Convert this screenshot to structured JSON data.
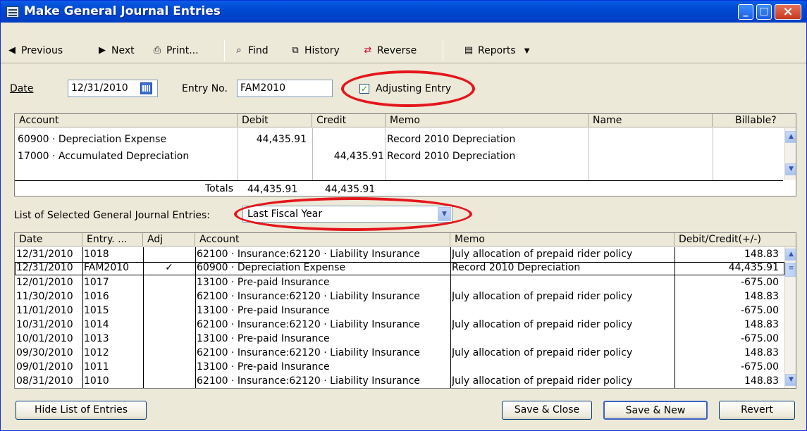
{
  "window": {
    "title": "Make General Journal Entries",
    "min": "_",
    "max": "□",
    "close": "×"
  },
  "toolbar": {
    "previous": "Previous",
    "next": "Next",
    "print": "Print...",
    "find": "Find",
    "history": "History",
    "reverse": "Reverse",
    "reports": "Reports",
    "reports_arrow": "▼"
  },
  "form": {
    "date_label": "Date",
    "date_value": "12/31/2010",
    "entry_label": "Entry No.",
    "entry_value": "FAM2010",
    "adjusting_label": "Adjusting Entry",
    "adjusting_checked": true
  },
  "entry_grid": {
    "columns": [
      "Account",
      "Debit",
      "Credit",
      "Memo",
      "Name",
      "Billable?"
    ],
    "rows": [
      {
        "account": "60900 · Depreciation Expense",
        "debit": "44,435.91",
        "credit": "",
        "memo": "Record 2010 Depreciation",
        "name": "",
        "billable": ""
      },
      {
        "account": "17000 · Accumulated Depreciation",
        "debit": "",
        "credit": "44,435.91",
        "memo": "Record 2010 Depreciation",
        "name": "",
        "billable": ""
      }
    ],
    "totals_label": "Totals",
    "total_debit": "44,435.91",
    "total_credit": "44,435.91"
  },
  "list_filter": {
    "label": "List of Selected General Journal Entries:",
    "value": "Last Fiscal Year"
  },
  "list_grid": {
    "columns": [
      "Date",
      "Entry. ...",
      "Adj",
      "Account",
      "Memo",
      "Debit/Credit(+/-)"
    ],
    "rows": [
      {
        "date": "12/31/2010",
        "entry": "1018",
        "adj": "",
        "account": "62100 · Insurance:62120 · Liability Insurance",
        "memo": "July allocation of prepaid rider policy",
        "amount": "148.83"
      },
      {
        "date": "12/31/2010",
        "entry": "FAM2010",
        "adj": "✓",
        "account": "60900 · Depreciation Expense",
        "memo": "Record 2010 Depreciation",
        "amount": "44,435.91"
      },
      {
        "date": "12/01/2010",
        "entry": "1017",
        "adj": "",
        "account": "13100 · Pre-paid Insurance",
        "memo": "",
        "amount": "-675.00"
      },
      {
        "date": "11/30/2010",
        "entry": "1016",
        "adj": "",
        "account": "62100 · Insurance:62120 · Liability Insurance",
        "memo": "July allocation of prepaid rider policy",
        "amount": "148.83"
      },
      {
        "date": "11/01/2010",
        "entry": "1015",
        "adj": "",
        "account": "13100 · Pre-paid Insurance",
        "memo": "",
        "amount": "-675.00"
      },
      {
        "date": "10/31/2010",
        "entry": "1014",
        "adj": "",
        "account": "62100 · Insurance:62120 · Liability Insurance",
        "memo": "July allocation of prepaid rider policy",
        "amount": "148.83"
      },
      {
        "date": "10/01/2010",
        "entry": "1013",
        "adj": "",
        "account": "13100 · Pre-paid Insurance",
        "memo": "",
        "amount": "-675.00"
      },
      {
        "date": "09/30/2010",
        "entry": "1012",
        "adj": "",
        "account": "62100 · Insurance:62120 · Liability Insurance",
        "memo": "July allocation of prepaid rider policy",
        "amount": "148.83"
      },
      {
        "date": "09/01/2010",
        "entry": "1011",
        "adj": "",
        "account": "13100 · Pre-paid Insurance",
        "memo": "",
        "amount": "-675.00"
      },
      {
        "date": "08/31/2010",
        "entry": "1010",
        "adj": "",
        "account": "62100 · Insurance:62120 · Liability Insurance",
        "memo": "July allocation of prepaid rider policy",
        "amount": "148.83"
      }
    ]
  },
  "buttons": {
    "hide_list": "Hide List of Entries",
    "save_close": "Save & Close",
    "save_new": "Save & New",
    "revert": "Revert"
  },
  "colors": {
    "title_bar": "#0049d1",
    "highlight_oval": "#e4161c",
    "check": "#21a121"
  }
}
